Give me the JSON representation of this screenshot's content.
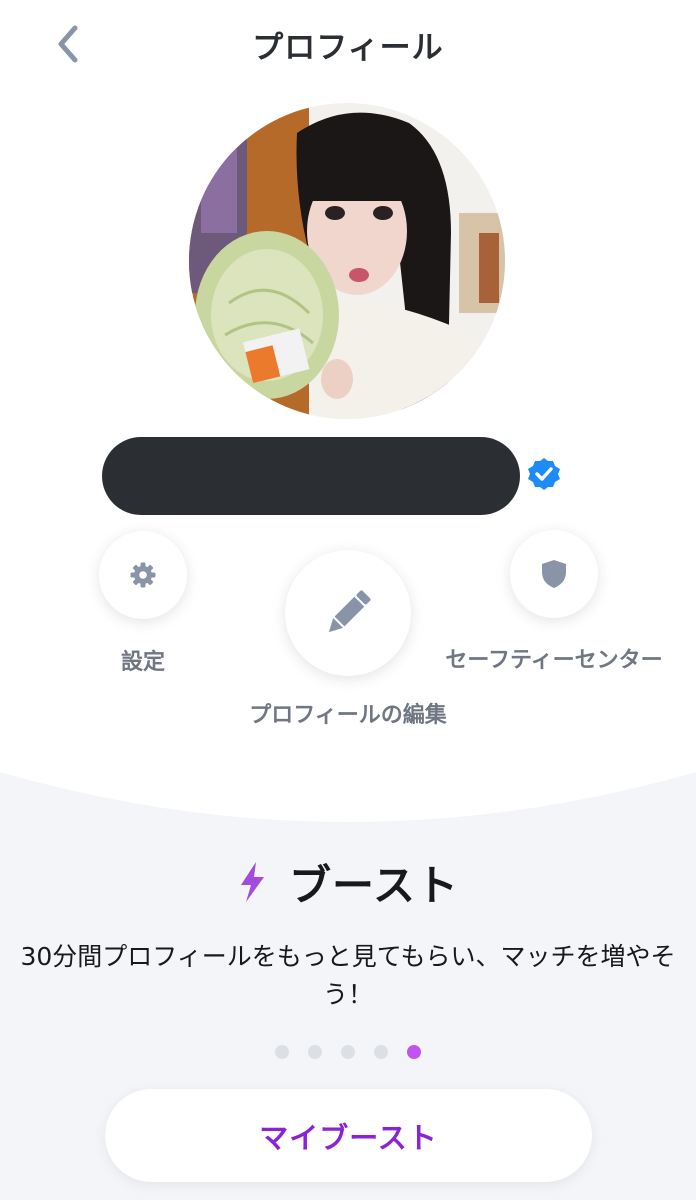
{
  "header": {
    "title": "プロフィール",
    "back_icon": "chevron-left-icon"
  },
  "profile": {
    "avatar_alt": "profile photo",
    "name_redacted": true,
    "verified_icon": "verified-check-icon",
    "verified_color": "#1d8cf8"
  },
  "actions": {
    "settings": {
      "label": "設定",
      "icon": "gear-icon"
    },
    "edit_profile": {
      "label": "プロフィールの編集",
      "icon": "pencil-icon"
    },
    "safety_center": {
      "label": "セーフティーセンター",
      "icon": "shield-icon"
    }
  },
  "boost": {
    "icon": "lightning-icon",
    "title": "ブースト",
    "description": "30分間プロフィールをもっと見てもらい、マッチを増やそう！",
    "carousel": {
      "total": 5,
      "active_index": 4
    },
    "button_label": "マイブースト",
    "accent_color": "#8a22d6"
  }
}
